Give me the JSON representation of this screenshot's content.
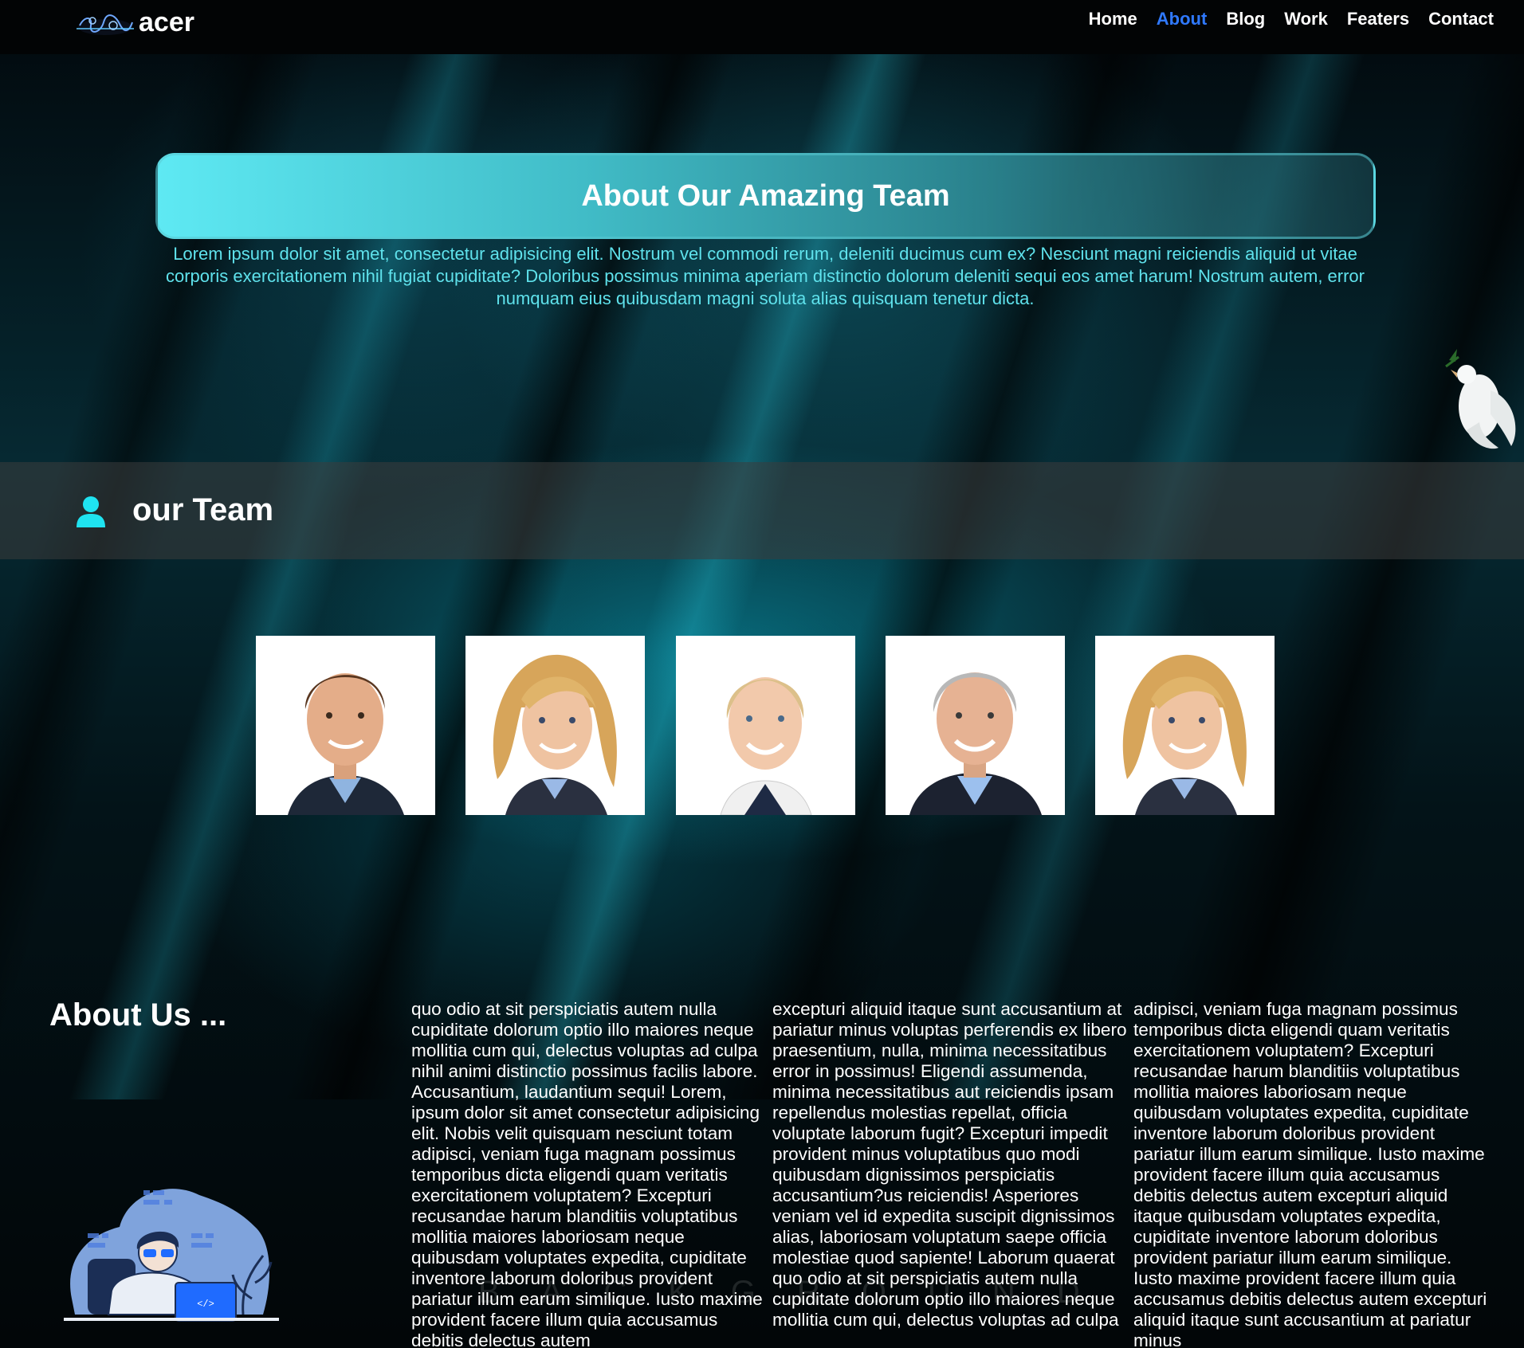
{
  "header": {
    "brand": "acer",
    "nav": [
      {
        "label": "Home",
        "active": false
      },
      {
        "label": "About",
        "active": true
      },
      {
        "label": "Blog",
        "active": false
      },
      {
        "label": "Work",
        "active": false
      },
      {
        "label": "Featers",
        "active": false
      },
      {
        "label": "Contact",
        "active": false
      }
    ]
  },
  "hero": {
    "title": "About Our Amazing Team",
    "text": "Lorem ipsum dolor sit amet, consectetur adipisicing elit. Nostrum vel commodi rerum, deleniti ducimus cum ex? Nesciunt magni reiciendis aliquid ut vitae corporis exercitationem nihil fugiat cupiditate? Doloribus possimus minima aperiam distinctio dolorum deleniti sequi eos amet harum! Nostrum autem, error numquam eius quibusdam magni soluta alias quisquam tenetur dicta."
  },
  "team": {
    "title": "our Team",
    "icon": "user-icon",
    "members": [
      {
        "photo": "young-man-portrait"
      },
      {
        "photo": "blonde-woman-portrait"
      },
      {
        "photo": "smiling-woman-portrait"
      },
      {
        "photo": "older-man-portrait"
      },
      {
        "photo": "blonde-woman-portrait"
      }
    ]
  },
  "about": {
    "title": "About Us ...",
    "columns": [
      "quo odio at sit perspiciatis autem nulla cupiditate dolorum optio illo maiores neque mollitia cum qui, delectus voluptas ad culpa nihil animi distinctio possimus facilis labore. Accusantium, laudantium sequi! Lorem, ipsum dolor sit amet consectetur adipisicing elit. Nobis velit quisquam nesciunt totam adipisci, veniam fuga magnam possimus temporibus dicta eligendi quam veritatis exercitationem voluptatem? Excepturi recusandae harum blanditiis voluptatibus mollitia maiores laboriosam neque quibusdam voluptates expedita, cupiditate inventore laborum doloribus provident pariatur illum earum similique. Iusto maxime provident facere illum quia accusamus debitis delectus autem",
      "excepturi aliquid itaque sunt accusantium at pariatur minus voluptas perferendis ex libero praesentium, nulla, minima necessitatibus error in possimus! Eligendi assumenda, minima necessitatibus aut reiciendis ipsam repellendus molestias repellat, officia voluptate laborum fugit? Excepturi impedit provident minus voluptatibus quo modi quibusdam dignissimos perspiciatis accusantium?us reiciendis! Asperiores veniam vel id expedita suscipit dignissimos alias, laboriosam voluptatum saepe officia molestiae quod sapiente! Laborum quaerat quo odio at sit perspiciatis autem nulla cupiditate dolorum optio illo maiores neque mollitia cum qui, delectus voluptas ad culpa",
      "adipisci, veniam fuga magnam possimus temporibus dicta eligendi quam veritatis exercitationem voluptatem? Excepturi recusandae harum blanditiis voluptatibus mollitia maiores laboriosam neque quibusdam voluptates expedita, cupiditate inventore laborum doloribus provident pariatur illum earum similique. Iusto maxime provident facere illum quia accusamus debitis delectus autem excepturi aliquid itaque quibusdam voluptates expedita, cupiditate inventore laborum doloribus provident pariatur illum earum similique. Iusto maxime provident facere illum quia accusamus debitis delectus autem excepturi aliquid itaque sunt accusantium at pariatur minus"
    ],
    "illustration": "developer-laptop-illustration"
  },
  "colors": {
    "accent": "#5fe2ec",
    "nav_active": "#2f79ff",
    "icon": "#1fe3f0"
  }
}
